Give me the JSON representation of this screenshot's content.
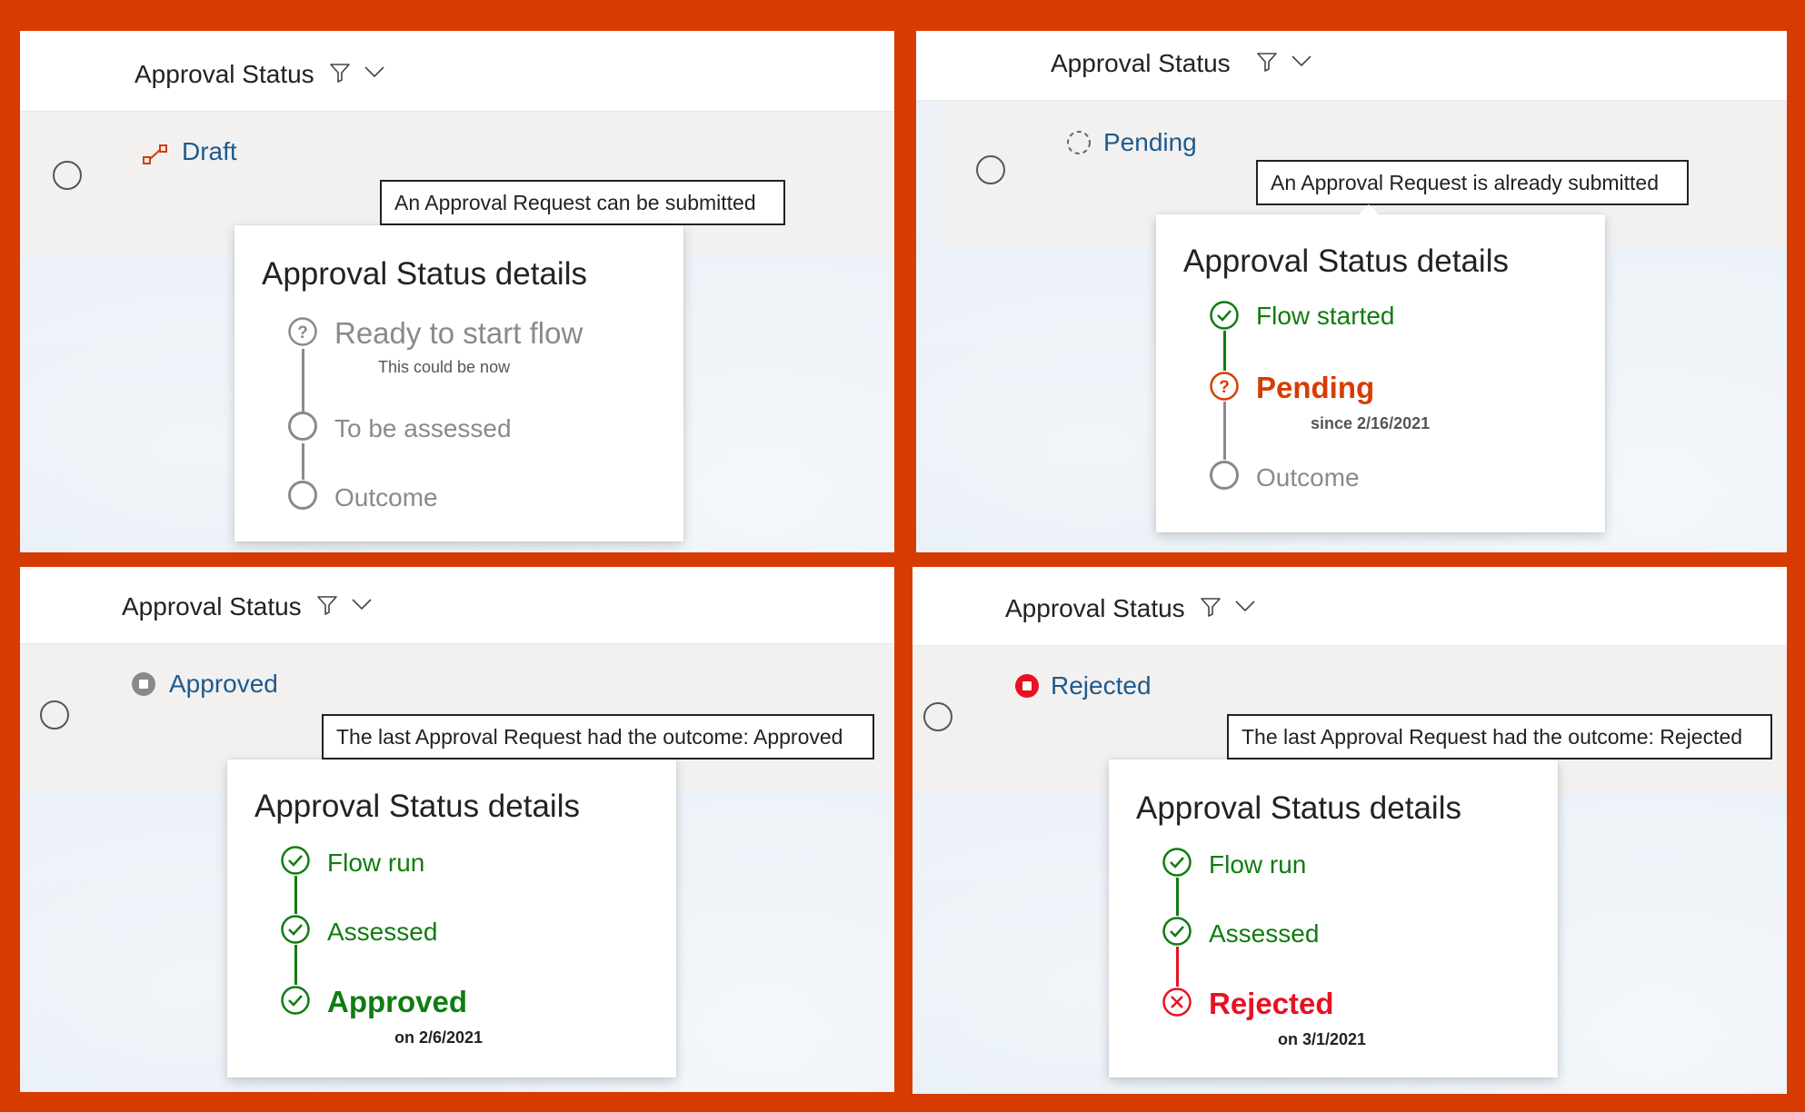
{
  "colors": {
    "frame": "#d83b01",
    "link": "#1f5a8c",
    "success": "#107c10",
    "pending": "#d83b01",
    "rejected": "#e81123",
    "inactive": "#8a8a8a"
  },
  "panels": [
    {
      "header": {
        "title": "Approval Status",
        "filter_icon": "filter-icon",
        "chevron_icon": "chevron-down-icon"
      },
      "status": {
        "label": "Draft",
        "icon": "draft-flow-icon"
      },
      "tooltip": "An Approval Request can be submitted",
      "details": {
        "title": "Approval Status details",
        "steps": [
          {
            "label": "Ready to start flow",
            "sub": "This could be now",
            "state": "question-inactive"
          },
          {
            "label": "To be assessed",
            "state": "empty"
          },
          {
            "label": "Outcome",
            "state": "empty"
          }
        ]
      }
    },
    {
      "header": {
        "title": "Approval Status",
        "filter_icon": "filter-icon",
        "chevron_icon": "chevron-down-icon"
      },
      "status": {
        "label": "Pending",
        "icon": "pending-spinner-icon"
      },
      "tooltip": "An Approval Request is already submitted",
      "details": {
        "title": "Approval Status details",
        "steps": [
          {
            "label": "Flow started",
            "state": "done"
          },
          {
            "label": "Pending",
            "sub": "since 2/16/2021",
            "state": "question-active"
          },
          {
            "label": "Outcome",
            "state": "empty"
          }
        ]
      }
    },
    {
      "header": {
        "title": "Approval Status",
        "filter_icon": "filter-icon",
        "chevron_icon": "chevron-down-icon"
      },
      "status": {
        "label": "Approved",
        "icon": "stop-grey-icon"
      },
      "tooltip": "The last Approval Request had the outcome: Approved",
      "details": {
        "title": "Approval Status details",
        "steps": [
          {
            "label": "Flow run",
            "state": "done"
          },
          {
            "label": "Assessed",
            "state": "done"
          },
          {
            "label": "Approved",
            "sub": "on 2/6/2021",
            "state": "done-final"
          }
        ]
      }
    },
    {
      "header": {
        "title": "Approval Status",
        "filter_icon": "filter-icon",
        "chevron_icon": "chevron-down-icon"
      },
      "status": {
        "label": "Rejected",
        "icon": "stop-red-icon"
      },
      "tooltip": "The last Approval Request had the outcome: Rejected",
      "details": {
        "title": "Approval Status details",
        "steps": [
          {
            "label": "Flow run",
            "state": "done"
          },
          {
            "label": "Assessed",
            "state": "done"
          },
          {
            "label": "Rejected",
            "sub": "on 3/1/2021",
            "state": "rejected"
          }
        ]
      }
    }
  ]
}
